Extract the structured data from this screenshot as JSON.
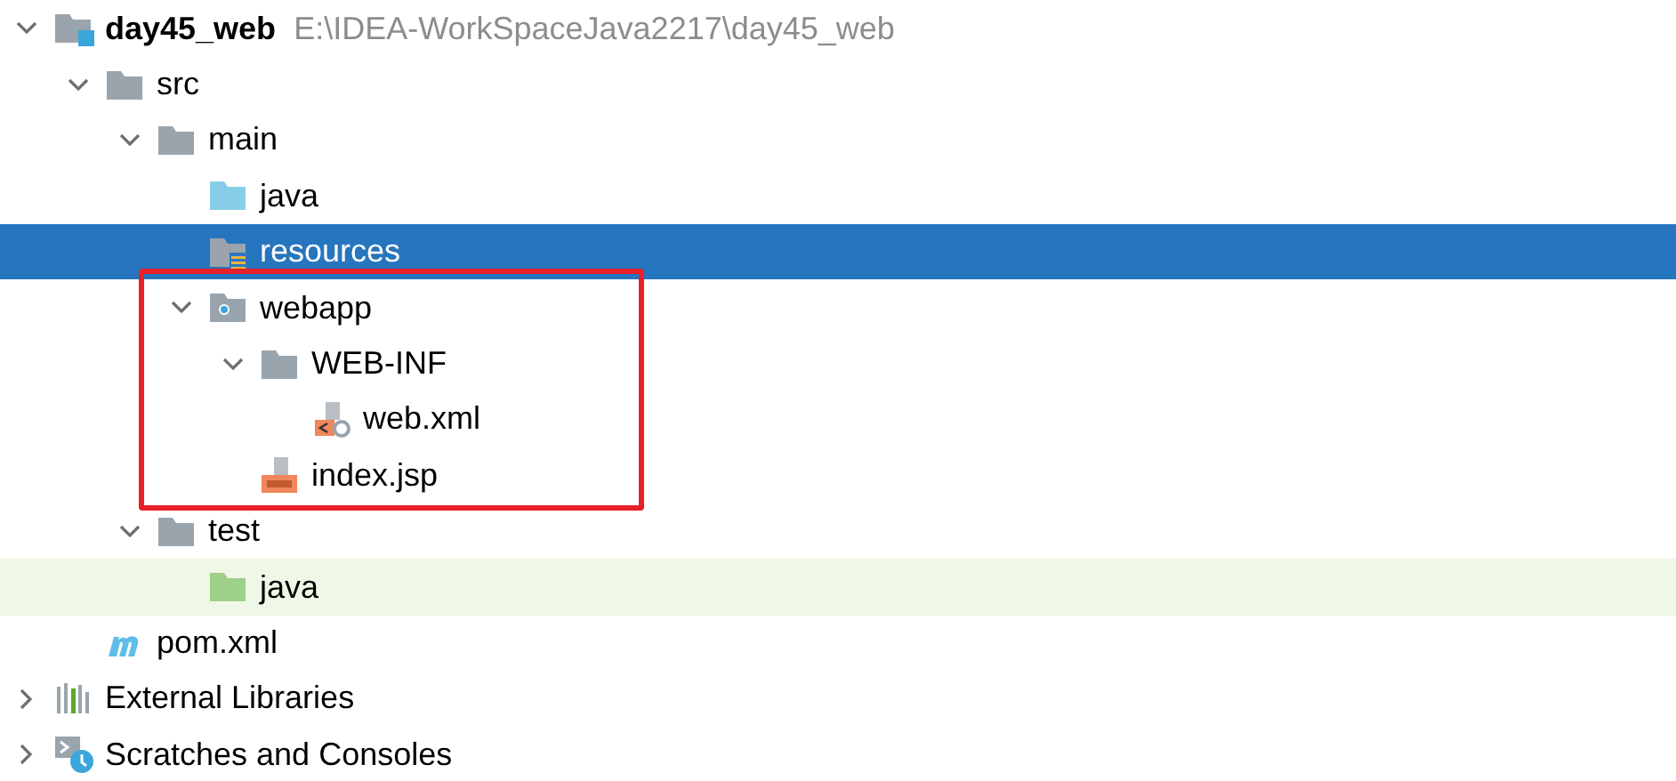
{
  "tree": [
    {
      "label": "day45_web",
      "path": "E:\\IDEA-WorkSpaceJava2217\\day45_web",
      "kind": "module",
      "expanded": true,
      "selected": false,
      "focused": false,
      "children": [
        {
          "label": "src",
          "kind": "folder",
          "expanded": true,
          "selected": false,
          "focused": false,
          "children": [
            {
              "label": "main",
              "kind": "folder",
              "expanded": true,
              "selected": false,
              "focused": false,
              "children": [
                {
                  "label": "java",
                  "kind": "source-folder",
                  "selected": false,
                  "focused": false
                },
                {
                  "label": "resources",
                  "kind": "resources-folder",
                  "selected": true,
                  "focused": false
                },
                {
                  "label": "webapp",
                  "kind": "web-folder",
                  "expanded": true,
                  "selected": false,
                  "focused": false,
                  "boxed": true,
                  "children": [
                    {
                      "label": "WEB-INF",
                      "kind": "folder",
                      "expanded": true,
                      "selected": false,
                      "focused": false,
                      "children": [
                        {
                          "label": "web.xml",
                          "kind": "xml-file",
                          "selected": false,
                          "focused": false
                        }
                      ]
                    },
                    {
                      "label": "index.jsp",
                      "kind": "jsp-file",
                      "selected": false,
                      "focused": false
                    }
                  ]
                }
              ]
            },
            {
              "label": "test",
              "kind": "folder",
              "expanded": true,
              "selected": false,
              "focused": false,
              "children": [
                {
                  "label": "java",
                  "kind": "test-folder",
                  "selected": false,
                  "focused": true
                }
              ]
            }
          ]
        },
        {
          "label": "pom.xml",
          "kind": "maven",
          "selected": false,
          "focused": false
        }
      ]
    },
    {
      "label": "External Libraries",
      "kind": "libraries",
      "expanded": false,
      "selected": false,
      "focused": false
    },
    {
      "label": "Scratches and Consoles",
      "kind": "scratches",
      "expanded": false,
      "selected": false,
      "focused": false
    }
  ]
}
